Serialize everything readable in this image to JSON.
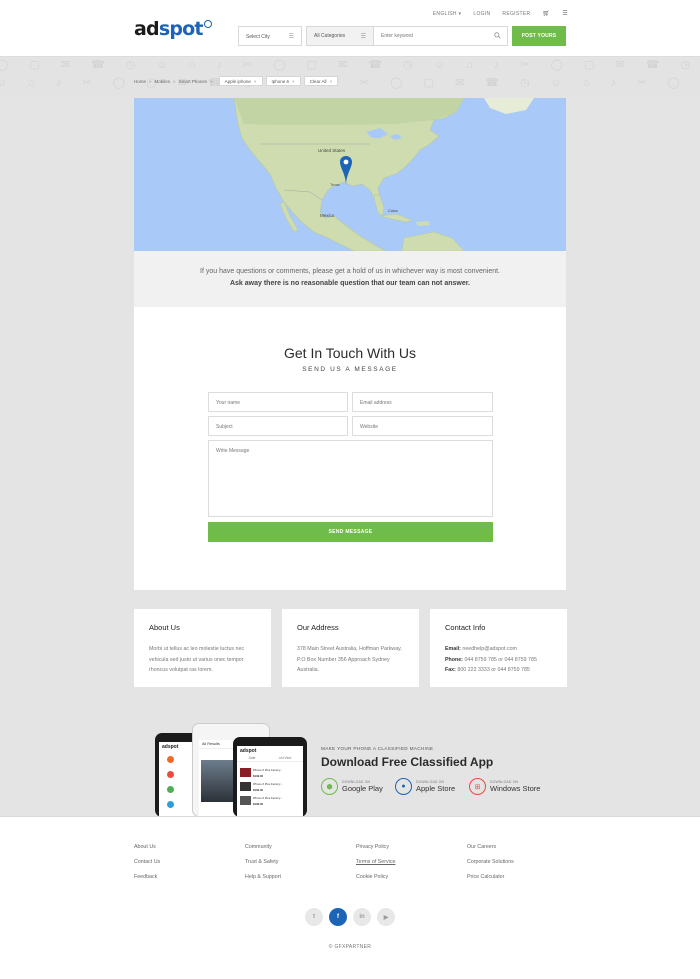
{
  "header": {
    "logo": {
      "part1": "ad",
      "part2": "spot"
    },
    "toplinks": {
      "language": "ENGLISH ▾",
      "login": "LOGIN",
      "register": "REGISTER"
    },
    "select_city": "Select City",
    "category": "All Categories",
    "keyword_placeholder": "Enter keyword",
    "post_button": "POST YOURS"
  },
  "breadcrumb": {
    "items": [
      "Home",
      "Mobiles",
      "Smart Phones"
    ],
    "chips": [
      "Apple iphone",
      "Iphone 6",
      "Clear All"
    ]
  },
  "map": {
    "labels": {
      "country": "United States",
      "mexico": "Mexico",
      "cuba": "Cuba",
      "texas": "Texas"
    }
  },
  "intro": {
    "line1": "If you have questions or comments, please get a hold of us in whichever way is most convenient.",
    "line2": "Ask away there is no reasonable question that our team can not answer."
  },
  "form": {
    "title": "Get In Touch With Us",
    "subtitle": "SEND US A MESSAGE",
    "name": "Your name",
    "email": "Email address",
    "subject": "Subject",
    "website": "Website",
    "message": "Write Message",
    "submit": "SEND MESSAGE"
  },
  "info": {
    "about": {
      "title": "About Us",
      "text": "Morbi ut tellus ac leo molestie luctus nec vehicula sed justo ut varius onec tempor rhoncus volutpat ras lorem."
    },
    "address": {
      "title": "Our Address",
      "text": "378 Main Street Australia, Hoffman Parkway, P.O Box Number 356 Approach Sydney Australia."
    },
    "contact": {
      "title": "Contact Info",
      "email_label": "Email:",
      "email": "needhelp@adspot.com",
      "phone_label": "Phone:",
      "phone": "044 8759 785 or 044 8759 785",
      "fax_label": "Fax:",
      "fax": "800 222 3333 or 044 8759 785"
    }
  },
  "app": {
    "kicker": "MAKE YOUR PHONE A CLASSIFIED MACHINE",
    "title": "Download Free Classified App",
    "download_on": "DOWNLOAD ON",
    "stores": [
      "Google Play",
      "Apple Store",
      "Windows Store"
    ],
    "phone_logo": "adspot",
    "phone_header": "All Results",
    "phone_tab_date": "Date",
    "phone_tab_list": "List View",
    "phone_price": "$199.00",
    "phone_item": "iPhone 6 Plus Factory..."
  },
  "footer": {
    "col1": [
      "About Us",
      "Contact Us",
      "Feedback"
    ],
    "col2": [
      "Community",
      "Trust & Safety",
      "Help & Support"
    ],
    "col3": [
      "Privacy Policy",
      "Terms of Service",
      "Cookie Policy"
    ],
    "col4": [
      "Our Careers",
      "Corporate Solutions",
      "Price Calculator"
    ],
    "copyright": "© GFXPARTNER"
  },
  "social": [
    "twitter-icon",
    "facebook-icon",
    "linkedin-icon",
    "youtube-icon"
  ],
  "colors": {
    "accent_green": "#70bc4a",
    "brand_blue": "#1d64b7",
    "map_water": "#a9c9f8",
    "map_land": "#cfdcb0"
  }
}
